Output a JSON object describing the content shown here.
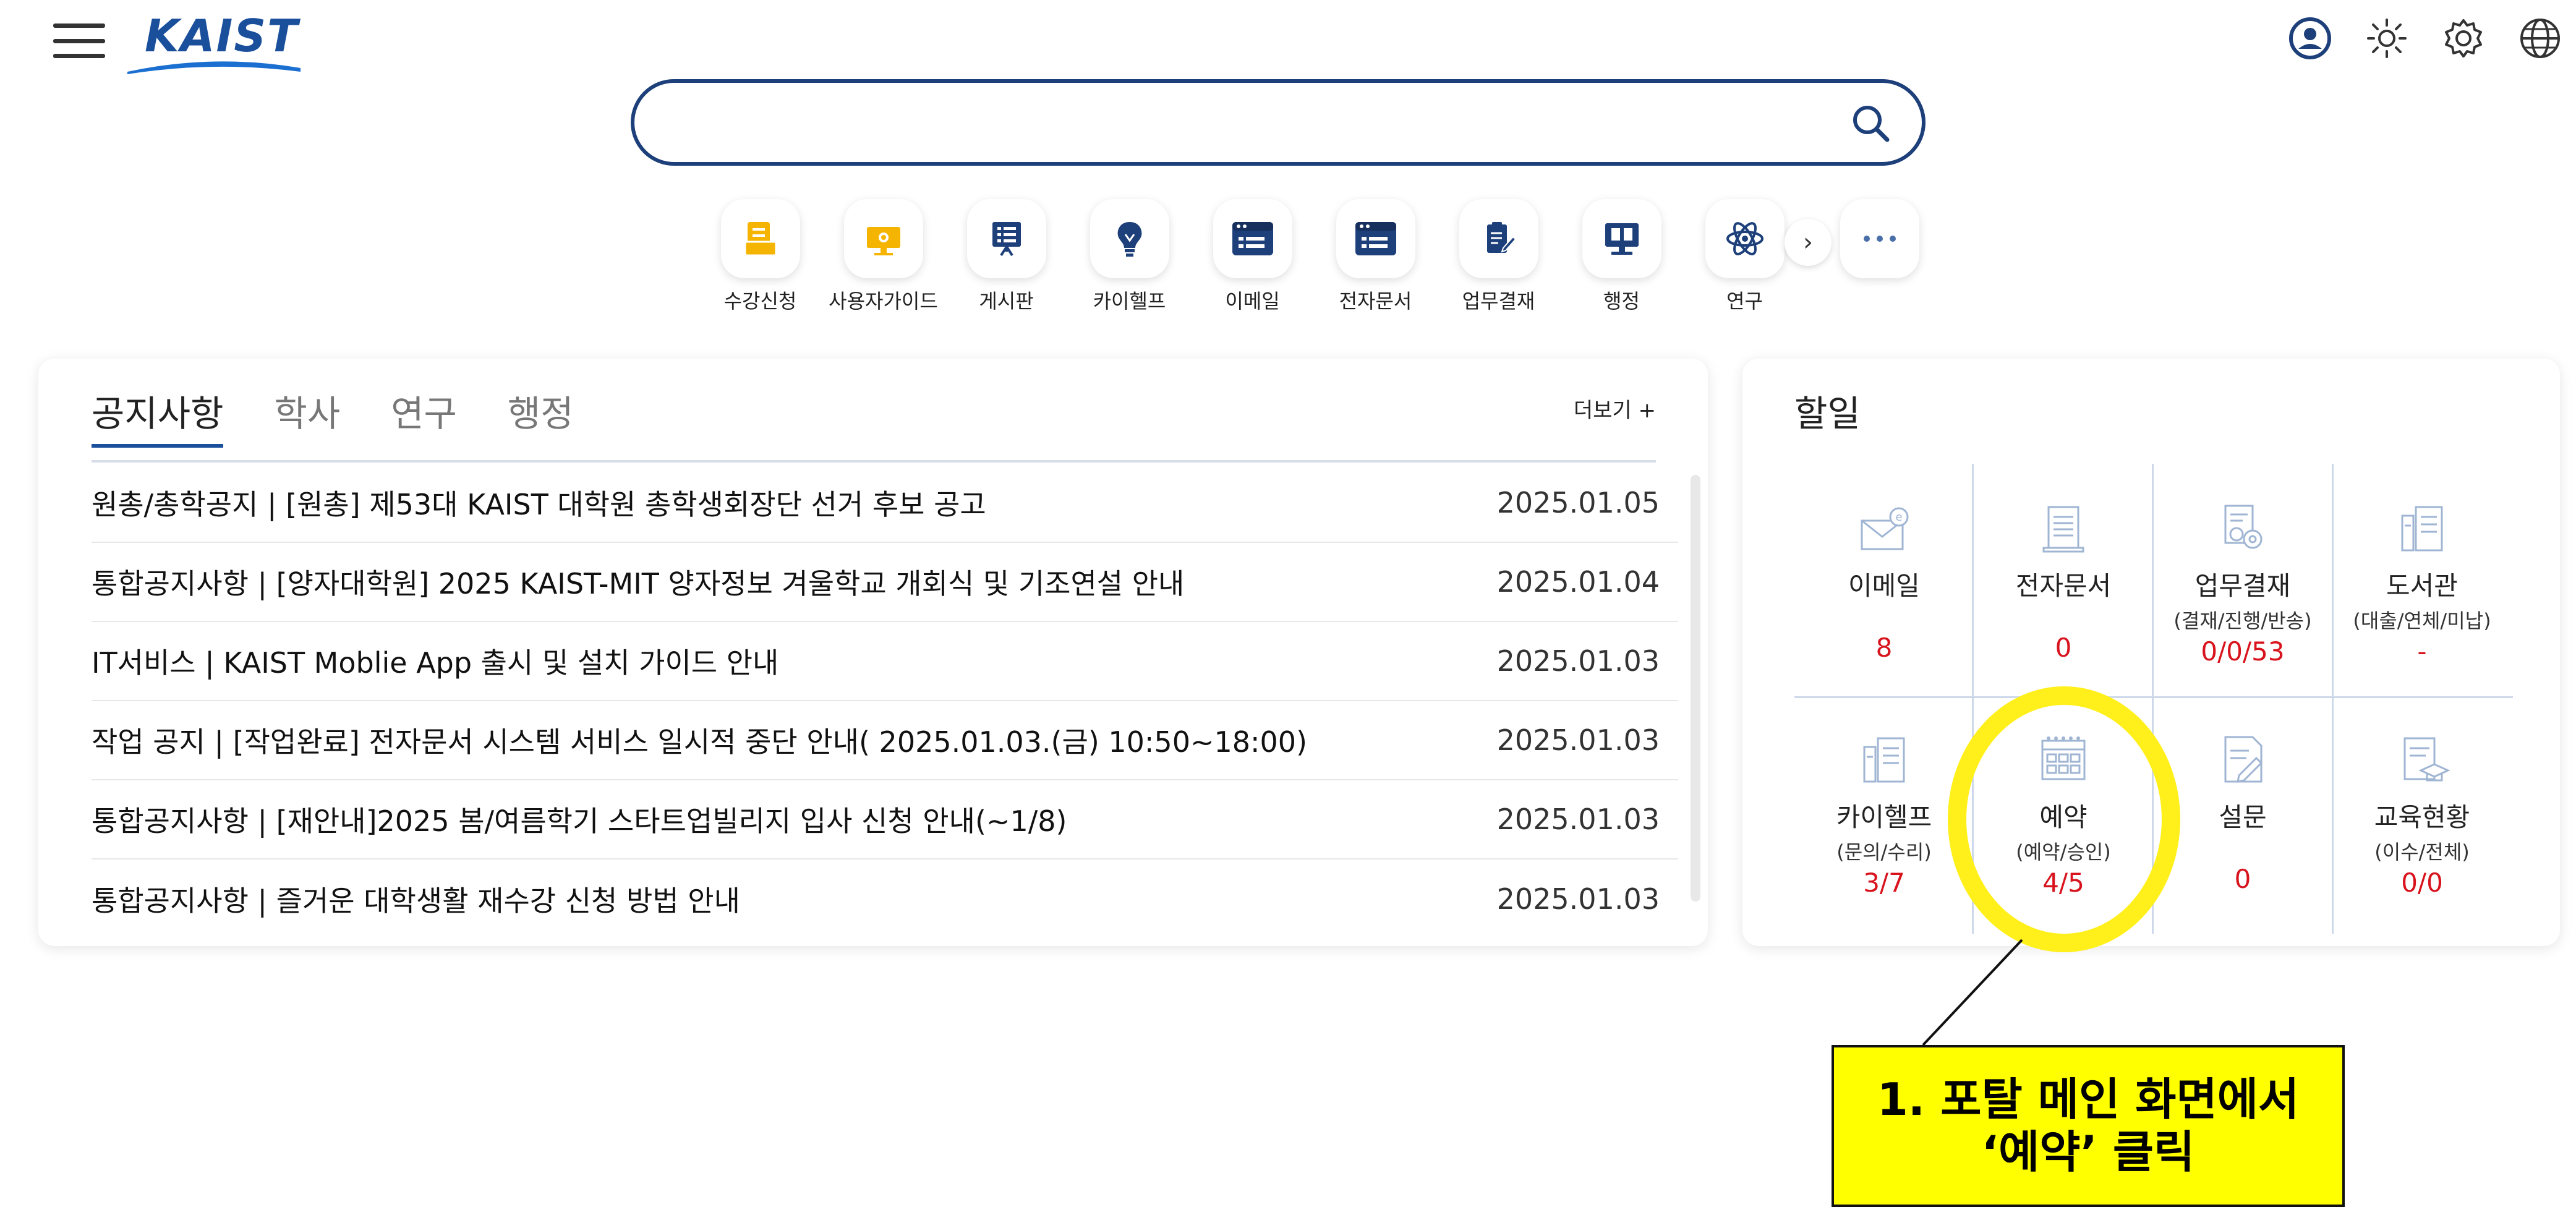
{
  "header": {
    "logo_text": "KAIST",
    "icons": [
      "user-circle-icon",
      "brightness-icon",
      "settings-gear-icon",
      "globe-icon"
    ]
  },
  "search": {
    "placeholder": ""
  },
  "quick_menu": {
    "items": [
      {
        "label": "수강신청",
        "icon": "course-registration-icon"
      },
      {
        "label": "사용자가이드",
        "icon": "user-guide-icon"
      },
      {
        "label": "게시판",
        "icon": "bulletin-board-icon"
      },
      {
        "label": "카이헬프",
        "icon": "lightbulb-icon"
      },
      {
        "label": "이메일",
        "icon": "email-icon"
      },
      {
        "label": "전자문서",
        "icon": "e-document-icon"
      },
      {
        "label": "업무결재",
        "icon": "approval-icon"
      },
      {
        "label": "행정",
        "icon": "administration-icon"
      },
      {
        "label": "연구",
        "icon": "research-atom-icon"
      }
    ],
    "next_label": "›"
  },
  "notice": {
    "tabs": [
      "공지사항",
      "학사",
      "연구",
      "행정"
    ],
    "more_label": "더보기 +",
    "rows": [
      {
        "title": "원총/총학공지 | [원총] 제53대 KAIST 대학원 총학생회장단 선거 후보 공고",
        "date": "2025.01.05"
      },
      {
        "title": "통합공지사항 | [양자대학원] 2025 KAIST-MIT 양자정보 겨울학교 개회식 및 기조연설 안내",
        "date": "2025.01.04"
      },
      {
        "title": "IT서비스 | KAIST Moblie App 출시 및 설치 가이드 안내",
        "date": "2025.01.03"
      },
      {
        "title": "작업 공지 | [작업완료] 전자문서 시스템 서비스 일시적 중단 안내( 2025.01.03.(금) 10:50~18:00)",
        "date": "2025.01.03"
      },
      {
        "title": "통합공지사항 | [재안내]2025 봄/여름학기 스타트업빌리지 입사 신청 안내(~1/8)",
        "date": "2025.01.03"
      },
      {
        "title": "통합공지사항 | 즐거운 대학생활 재수강 신청 방법 안내",
        "date": "2025.01.03"
      }
    ]
  },
  "todo": {
    "title": "할일",
    "cells": [
      {
        "label": "이메일",
        "sub": "",
        "value": "8",
        "icon": "email-icon"
      },
      {
        "label": "전자문서",
        "sub": "",
        "value": "0",
        "icon": "document-icon"
      },
      {
        "label": "업무결재",
        "sub": "(결재/진행/반송)",
        "value": "0/0/53",
        "icon": "approval-gear-icon"
      },
      {
        "label": "도서관",
        "sub": "(대출/연체/미납)",
        "value": "-",
        "icon": "library-icon"
      },
      {
        "label": "카이헬프",
        "sub": "(문의/수리)",
        "value": "3/7",
        "icon": "help-icon"
      },
      {
        "label": "예약",
        "sub": "(예약/승인)",
        "value": "4/5",
        "icon": "calendar-icon"
      },
      {
        "label": "설문",
        "sub": "",
        "value": "0",
        "icon": "survey-icon"
      },
      {
        "label": "교육현황",
        "sub": "(이수/전체)",
        "value": "0/0",
        "icon": "education-icon"
      }
    ]
  },
  "annotation": {
    "text": "1. 포탈 메인 화면에서\n‘예약’ 클릭",
    "highlight_color": "#ffef1a",
    "box_color": "#ffff00"
  }
}
